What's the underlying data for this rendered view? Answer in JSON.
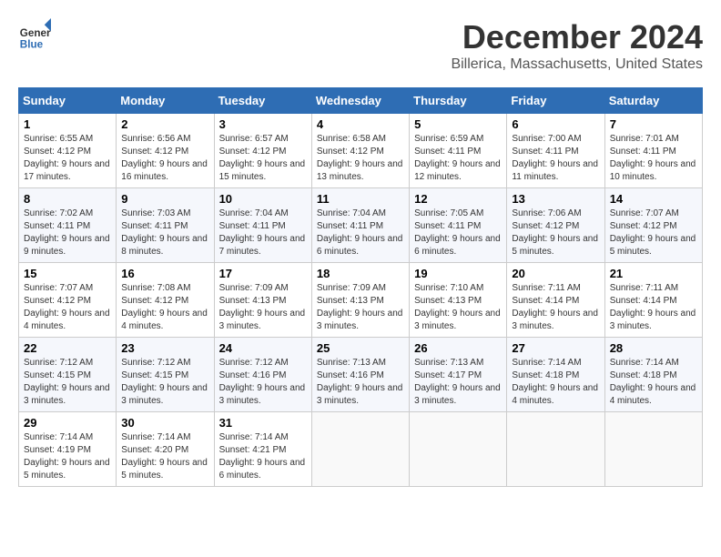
{
  "logo": {
    "general": "General",
    "blue": "Blue"
  },
  "title": {
    "month": "December 2024",
    "location": "Billerica, Massachusetts, United States"
  },
  "weekdays": [
    "Sunday",
    "Monday",
    "Tuesday",
    "Wednesday",
    "Thursday",
    "Friday",
    "Saturday"
  ],
  "weeks": [
    [
      {
        "day": "1",
        "sunrise": "Sunrise: 6:55 AM",
        "sunset": "Sunset: 4:12 PM",
        "daylight": "Daylight: 9 hours and 17 minutes."
      },
      {
        "day": "2",
        "sunrise": "Sunrise: 6:56 AM",
        "sunset": "Sunset: 4:12 PM",
        "daylight": "Daylight: 9 hours and 16 minutes."
      },
      {
        "day": "3",
        "sunrise": "Sunrise: 6:57 AM",
        "sunset": "Sunset: 4:12 PM",
        "daylight": "Daylight: 9 hours and 15 minutes."
      },
      {
        "day": "4",
        "sunrise": "Sunrise: 6:58 AM",
        "sunset": "Sunset: 4:12 PM",
        "daylight": "Daylight: 9 hours and 13 minutes."
      },
      {
        "day": "5",
        "sunrise": "Sunrise: 6:59 AM",
        "sunset": "Sunset: 4:11 PM",
        "daylight": "Daylight: 9 hours and 12 minutes."
      },
      {
        "day": "6",
        "sunrise": "Sunrise: 7:00 AM",
        "sunset": "Sunset: 4:11 PM",
        "daylight": "Daylight: 9 hours and 11 minutes."
      },
      {
        "day": "7",
        "sunrise": "Sunrise: 7:01 AM",
        "sunset": "Sunset: 4:11 PM",
        "daylight": "Daylight: 9 hours and 10 minutes."
      }
    ],
    [
      {
        "day": "8",
        "sunrise": "Sunrise: 7:02 AM",
        "sunset": "Sunset: 4:11 PM",
        "daylight": "Daylight: 9 hours and 9 minutes."
      },
      {
        "day": "9",
        "sunrise": "Sunrise: 7:03 AM",
        "sunset": "Sunset: 4:11 PM",
        "daylight": "Daylight: 9 hours and 8 minutes."
      },
      {
        "day": "10",
        "sunrise": "Sunrise: 7:04 AM",
        "sunset": "Sunset: 4:11 PM",
        "daylight": "Daylight: 9 hours and 7 minutes."
      },
      {
        "day": "11",
        "sunrise": "Sunrise: 7:04 AM",
        "sunset": "Sunset: 4:11 PM",
        "daylight": "Daylight: 9 hours and 6 minutes."
      },
      {
        "day": "12",
        "sunrise": "Sunrise: 7:05 AM",
        "sunset": "Sunset: 4:11 PM",
        "daylight": "Daylight: 9 hours and 6 minutes."
      },
      {
        "day": "13",
        "sunrise": "Sunrise: 7:06 AM",
        "sunset": "Sunset: 4:12 PM",
        "daylight": "Daylight: 9 hours and 5 minutes."
      },
      {
        "day": "14",
        "sunrise": "Sunrise: 7:07 AM",
        "sunset": "Sunset: 4:12 PM",
        "daylight": "Daylight: 9 hours and 5 minutes."
      }
    ],
    [
      {
        "day": "15",
        "sunrise": "Sunrise: 7:07 AM",
        "sunset": "Sunset: 4:12 PM",
        "daylight": "Daylight: 9 hours and 4 minutes."
      },
      {
        "day": "16",
        "sunrise": "Sunrise: 7:08 AM",
        "sunset": "Sunset: 4:12 PM",
        "daylight": "Daylight: 9 hours and 4 minutes."
      },
      {
        "day": "17",
        "sunrise": "Sunrise: 7:09 AM",
        "sunset": "Sunset: 4:13 PM",
        "daylight": "Daylight: 9 hours and 3 minutes."
      },
      {
        "day": "18",
        "sunrise": "Sunrise: 7:09 AM",
        "sunset": "Sunset: 4:13 PM",
        "daylight": "Daylight: 9 hours and 3 minutes."
      },
      {
        "day": "19",
        "sunrise": "Sunrise: 7:10 AM",
        "sunset": "Sunset: 4:13 PM",
        "daylight": "Daylight: 9 hours and 3 minutes."
      },
      {
        "day": "20",
        "sunrise": "Sunrise: 7:11 AM",
        "sunset": "Sunset: 4:14 PM",
        "daylight": "Daylight: 9 hours and 3 minutes."
      },
      {
        "day": "21",
        "sunrise": "Sunrise: 7:11 AM",
        "sunset": "Sunset: 4:14 PM",
        "daylight": "Daylight: 9 hours and 3 minutes."
      }
    ],
    [
      {
        "day": "22",
        "sunrise": "Sunrise: 7:12 AM",
        "sunset": "Sunset: 4:15 PM",
        "daylight": "Daylight: 9 hours and 3 minutes."
      },
      {
        "day": "23",
        "sunrise": "Sunrise: 7:12 AM",
        "sunset": "Sunset: 4:15 PM",
        "daylight": "Daylight: 9 hours and 3 minutes."
      },
      {
        "day": "24",
        "sunrise": "Sunrise: 7:12 AM",
        "sunset": "Sunset: 4:16 PM",
        "daylight": "Daylight: 9 hours and 3 minutes."
      },
      {
        "day": "25",
        "sunrise": "Sunrise: 7:13 AM",
        "sunset": "Sunset: 4:16 PM",
        "daylight": "Daylight: 9 hours and 3 minutes."
      },
      {
        "day": "26",
        "sunrise": "Sunrise: 7:13 AM",
        "sunset": "Sunset: 4:17 PM",
        "daylight": "Daylight: 9 hours and 3 minutes."
      },
      {
        "day": "27",
        "sunrise": "Sunrise: 7:14 AM",
        "sunset": "Sunset: 4:18 PM",
        "daylight": "Daylight: 9 hours and 4 minutes."
      },
      {
        "day": "28",
        "sunrise": "Sunrise: 7:14 AM",
        "sunset": "Sunset: 4:18 PM",
        "daylight": "Daylight: 9 hours and 4 minutes."
      }
    ],
    [
      {
        "day": "29",
        "sunrise": "Sunrise: 7:14 AM",
        "sunset": "Sunset: 4:19 PM",
        "daylight": "Daylight: 9 hours and 5 minutes."
      },
      {
        "day": "30",
        "sunrise": "Sunrise: 7:14 AM",
        "sunset": "Sunset: 4:20 PM",
        "daylight": "Daylight: 9 hours and 5 minutes."
      },
      {
        "day": "31",
        "sunrise": "Sunrise: 7:14 AM",
        "sunset": "Sunset: 4:21 PM",
        "daylight": "Daylight: 9 hours and 6 minutes."
      },
      null,
      null,
      null,
      null
    ]
  ]
}
